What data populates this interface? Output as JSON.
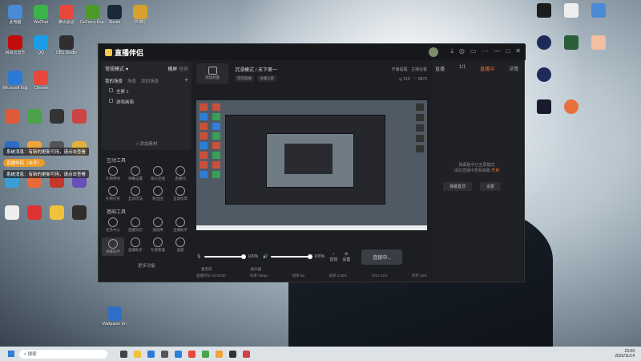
{
  "desktop_icons": [
    {
      "label": "此电脑",
      "color": "#4b8bd6"
    },
    {
      "label": "WeChat",
      "color": "#3bb54a"
    },
    {
      "label": "腾讯会议",
      "color": "#e8473b"
    },
    {
      "label": "GeForce Experience",
      "color": "#4c9a2a"
    },
    {
      "label": "Steam",
      "color": "#1b2838"
    },
    {
      "label": "PUBG",
      "color": "#d8a12e"
    },
    {
      "label": "网易云音乐",
      "color": "#c20c0c"
    },
    {
      "label": "QQ",
      "color": "#1a9ee8"
    },
    {
      "label": "OBS Studio",
      "color": "#302e31"
    },
    {
      "label": "Microsoft Edge",
      "color": "#2a7ad8"
    },
    {
      "label": "Chrome",
      "color": "#e8473b"
    },
    {
      "label": "Wallpaper Engine",
      "color": "#2f6fc8"
    }
  ],
  "notifications": [
    "系统消息：有新的更新可用，请点击查看",
    "系统消息：有新的更新可用，请点击查看"
  ],
  "notif_tag": "直播伴侣（未开）",
  "app": {
    "title": "直播伴侣",
    "window_controls": [
      "⤓",
      "◎",
      "▭",
      "⋯",
      "—",
      "□",
      "✕"
    ],
    "scene": {
      "mode": "常规模式 ♥",
      "switch": "横屏",
      "switch2": "竖屏",
      "tabs": [
        "我的场景",
        "场景",
        "添加场景"
      ],
      "items": [
        "全屏 1",
        "游戏画面"
      ],
      "add_source": "+ 添加素材"
    },
    "tools_title": "互动工具",
    "tools": [
      "礼物特效",
      "弹幕设置",
      "观众连线",
      "直播间",
      "礼物打赏",
      "互动玩法",
      "粉丝团",
      "互动投票"
    ],
    "basic_title": "基础工具",
    "basic": [
      "任务中心",
      "直播日历",
      "道具库",
      "主播助手",
      "弹幕助手",
      "直播助手",
      "礼物管理",
      "美颜"
    ],
    "more": "更多功能",
    "live": {
      "cover_label": "添加封面",
      "title": "沉浸模式 / 天下第一",
      "tags": [
        "游戏直播",
        "主播之家"
      ],
      "right1": "开播提醒",
      "right2": "主播设置",
      "viewers": "215",
      "likes": "9872"
    },
    "audio": {
      "mic_label": "麦克风",
      "mic_value": "100%",
      "speaker_label": "扬声器",
      "speaker_value": "100%",
      "settings_label": "设置",
      "extra_label": "音效",
      "go_live": "连接中..."
    },
    "status": [
      "直播时长 00:00:00",
      "码率 0kbps",
      "帧率 60",
      "丢帧 0.00%",
      "CPU 21%",
      "内存 45%"
    ],
    "right_panel": {
      "tab": "直播",
      "count": "1/1",
      "live_tag": "直播中",
      "detail": "详情",
      "msg1": "弹幕助手已全屏模式",
      "msg2": "请在直播中查看弹幕",
      "msg_hl": "开启",
      "btn1": "弹幕置顶",
      "btn2": "设置"
    }
  },
  "taskbar": {
    "search": "搜索",
    "time": "23:09",
    "date": "2023/11/14"
  }
}
